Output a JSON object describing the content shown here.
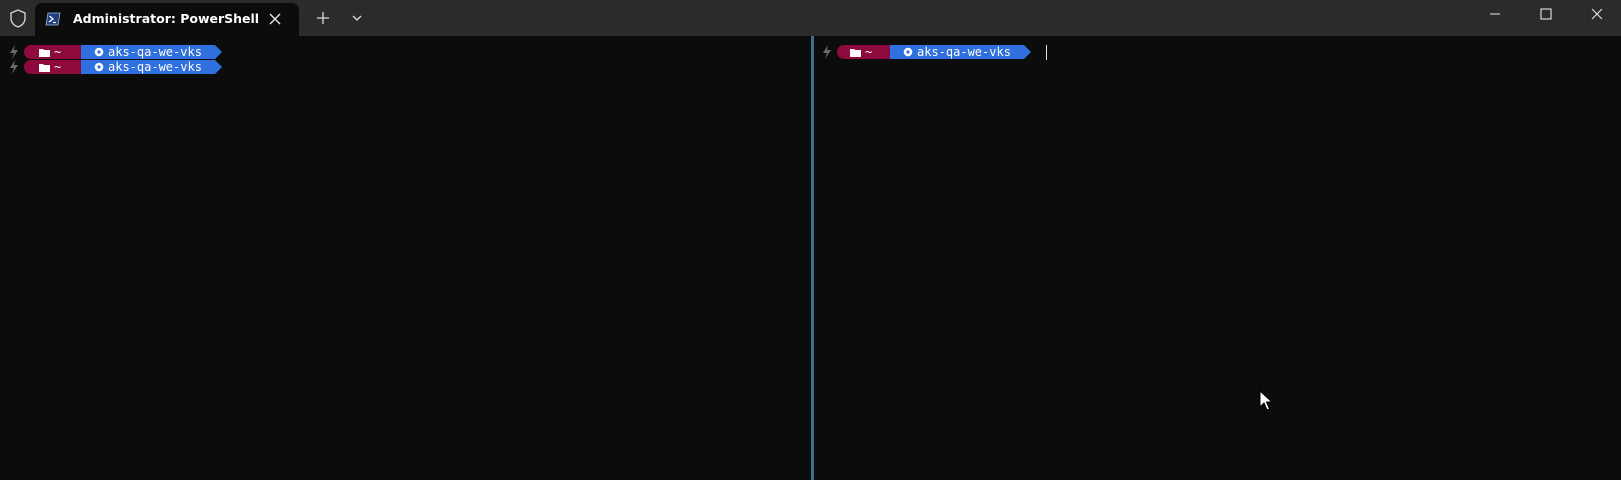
{
  "window": {
    "tab_title": "Administrator: PowerShell",
    "icons": {
      "shield": "shield-icon",
      "powershell": "powershell-icon",
      "close_tab": "close-icon",
      "new_tab": "plus-icon",
      "dropdown": "chevron-down-icon",
      "minimize": "minimize-icon",
      "maximize": "maximize-icon",
      "close_window": "close-icon"
    }
  },
  "prompt": {
    "path": "~",
    "context": "aks-qa-we-vks"
  },
  "colors": {
    "background": "#0c0c0c",
    "titlebar": "#2b2b2b",
    "path_segment": "#8f0a3c",
    "context_segment": "#2f6fe0",
    "divider": "#3a6f8f"
  }
}
